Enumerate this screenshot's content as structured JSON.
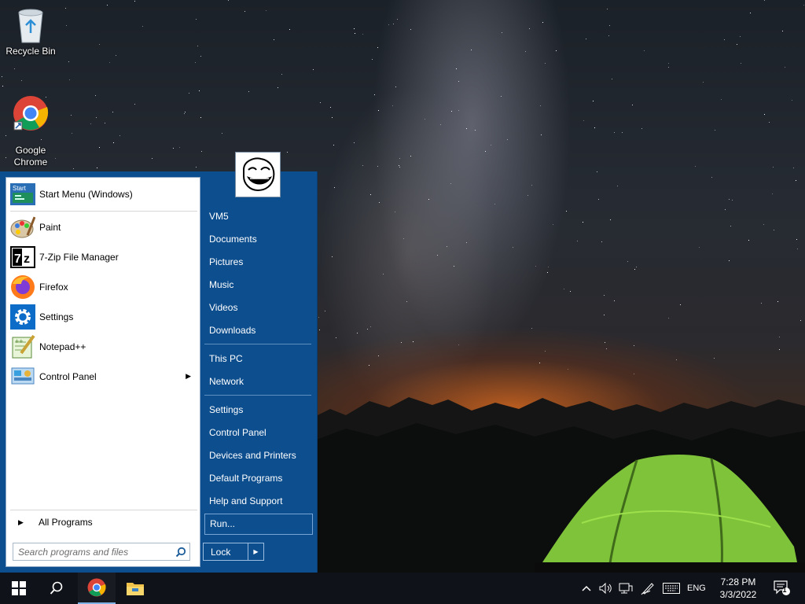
{
  "desktop": {
    "icons": [
      {
        "label": "Recycle Bin",
        "icon": "recycle-bin-icon"
      },
      {
        "label": "Google\nChrome",
        "icon": "chrome-icon"
      }
    ]
  },
  "start_menu": {
    "pinned": {
      "label": "Start Menu (Windows)",
      "icon": "start-menu-icon"
    },
    "programs": [
      {
        "label": "Paint",
        "icon": "paint-icon"
      },
      {
        "label": "7-Zip File Manager",
        "icon": "7zip-icon"
      },
      {
        "label": "Firefox",
        "icon": "firefox-icon"
      },
      {
        "label": "Settings",
        "icon": "settings-gear-icon"
      },
      {
        "label": "Notepad++",
        "icon": "notepadpp-icon"
      },
      {
        "label": "Control Panel",
        "icon": "control-panel-icon",
        "submenu": true
      }
    ],
    "all_programs": "All Programs",
    "search_placeholder": "Search programs and files",
    "places_group1": [
      "VM5",
      "Documents",
      "Pictures",
      "Music",
      "Videos",
      "Downloads"
    ],
    "places_group2": [
      "This PC",
      "Network"
    ],
    "places_group3": [
      "Settings",
      "Control Panel",
      "Devices and Printers",
      "Default Programs",
      "Help and Support",
      "Run..."
    ],
    "lock_label": "Lock"
  },
  "taskbar": {
    "clock_time": "7:28 PM",
    "clock_date": "3/3/2022",
    "language": "ENG",
    "notification_count": "1",
    "colors": {
      "taskbar": "#0f1218",
      "start_menu": "#0d4e8e",
      "active_indicator": "#7fb2e5"
    }
  }
}
